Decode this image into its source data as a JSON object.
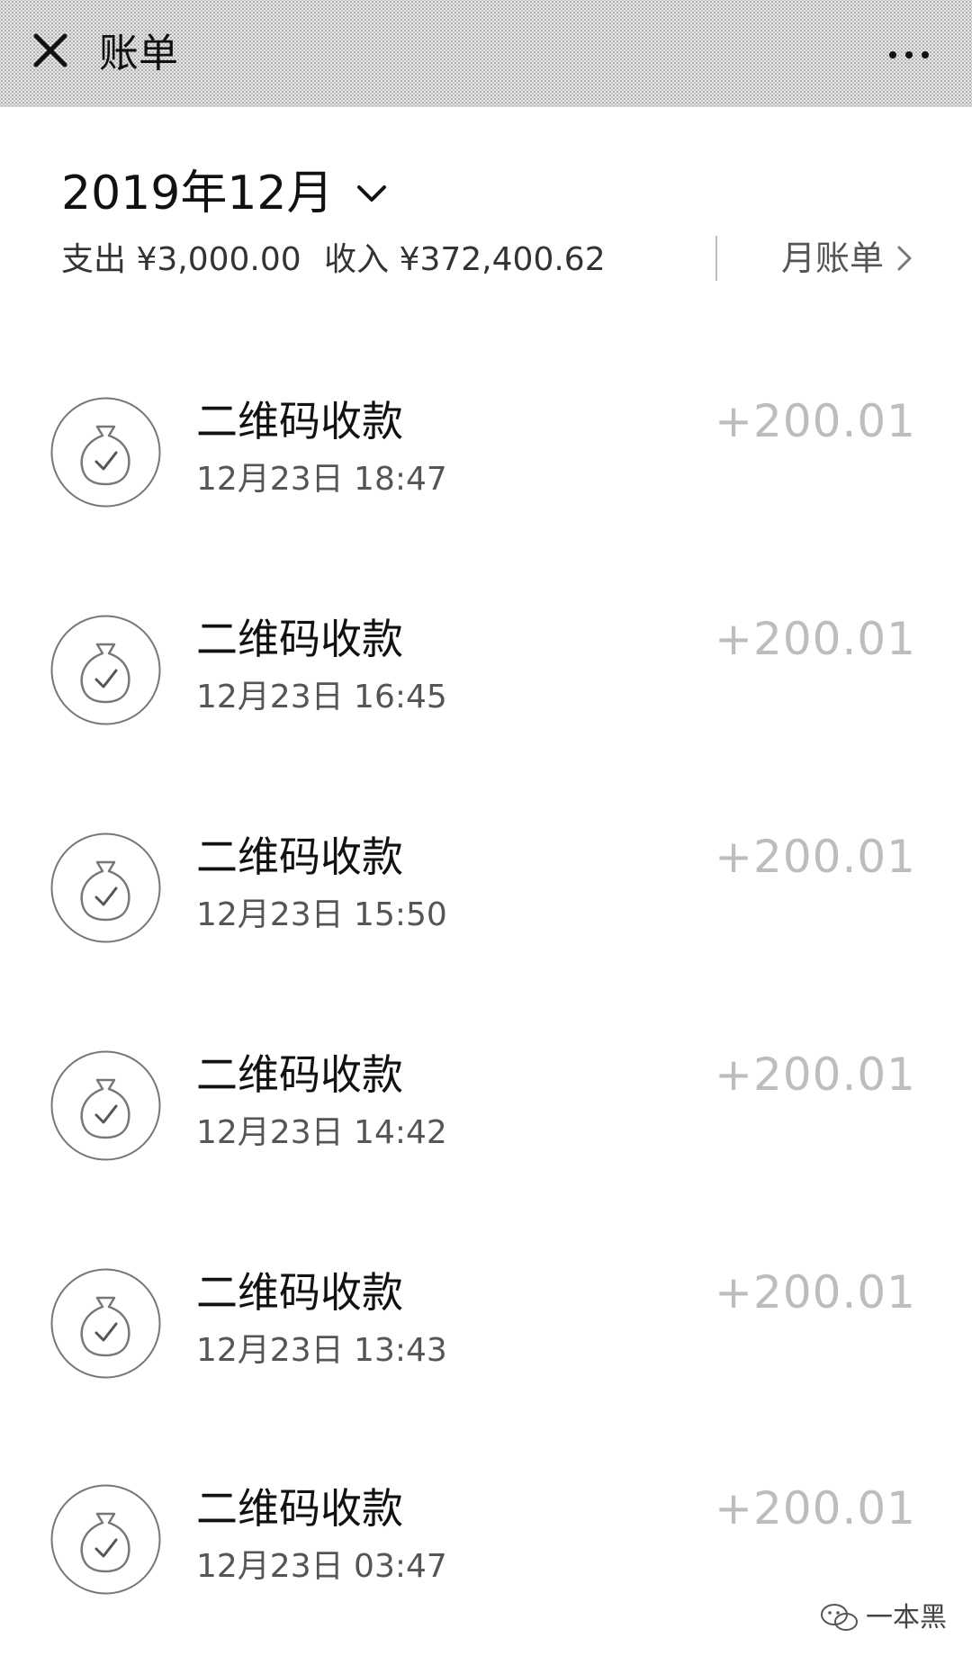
{
  "header": {
    "title": "账单"
  },
  "month": {
    "label": "2019年12月"
  },
  "summary": {
    "expense": "支出 ¥3,000.00",
    "income": "收入 ¥372,400.62",
    "monthly_bill_label": "月账单"
  },
  "transactions": [
    {
      "title": "二维码收款",
      "time": "12月23日 18:47",
      "amount": "+200.01"
    },
    {
      "title": "二维码收款",
      "time": "12月23日 16:45",
      "amount": "+200.01"
    },
    {
      "title": "二维码收款",
      "time": "12月23日 15:50",
      "amount": "+200.01"
    },
    {
      "title": "二维码收款",
      "time": "12月23日 14:42",
      "amount": "+200.01"
    },
    {
      "title": "二维码收款",
      "time": "12月23日 13:43",
      "amount": "+200.01"
    },
    {
      "title": "二维码收款",
      "time": "12月23日 03:47",
      "amount": "+200.01"
    }
  ],
  "watermark": {
    "text": "一本黑"
  },
  "icons": {
    "close": "close-icon",
    "more": "more-icon",
    "chevron_down": "chevron-down-icon",
    "chevron_right": "chevron-right-icon",
    "money_bag": "money-bag-icon",
    "wechat": "wechat-icon"
  },
  "colors": {
    "header_bg": "#e6e6e6",
    "amount_text": "#bdbdbd"
  }
}
